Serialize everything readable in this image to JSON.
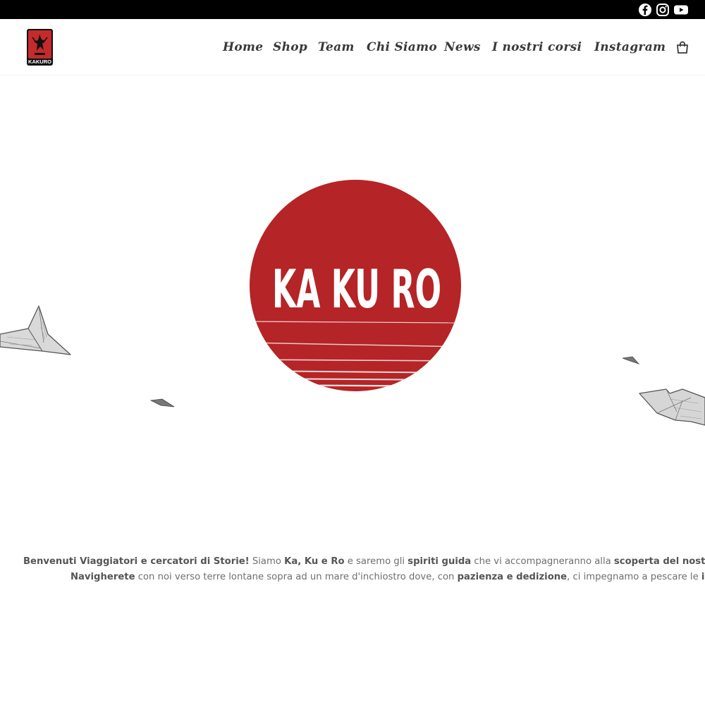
{
  "brand": {
    "logo_text": "KAKURO",
    "hero_title": "KA KU RO",
    "accent": "#b52426",
    "topbar_color": "#000000"
  },
  "social": [
    {
      "name": "facebook-icon"
    },
    {
      "name": "instagram-icon"
    },
    {
      "name": "youtube-icon"
    }
  ],
  "nav": {
    "items": [
      {
        "label": "Home"
      },
      {
        "label": "Shop"
      },
      {
        "label": "Team"
      },
      {
        "label": "Chi Siamo"
      },
      {
        "label": "News"
      },
      {
        "label": "I nostri corsi"
      },
      {
        "label": "Instagram"
      }
    ],
    "cart_icon": "shopping-bag-icon"
  },
  "welcome": {
    "line1": [
      {
        "t": "Benvenuti Viaggiatori e cercatori di Storie!",
        "b": true
      },
      {
        "t": " Siamo ",
        "b": false
      },
      {
        "t": "Ka, Ku e Ro",
        "b": true
      },
      {
        "t": " e saremo gli ",
        "b": false
      },
      {
        "t": "spiriti guida",
        "b": true
      },
      {
        "t": " che vi accompagneranno alla ",
        "b": false
      },
      {
        "t": "scoperta del nostro piccolo e prezio",
        "b": true
      }
    ],
    "line2": [
      {
        "t": "Navigherete",
        "b": true
      },
      {
        "t": " con noi verso terre lontane sopra ad un mare d'inchiostro dove, con ",
        "b": false
      },
      {
        "t": "pazienza e dedizione",
        "b": true
      },
      {
        "t": ", ci impegnamo a pescare le ",
        "b": false
      },
      {
        "t": "idee migliori",
        "b": true
      }
    ]
  }
}
